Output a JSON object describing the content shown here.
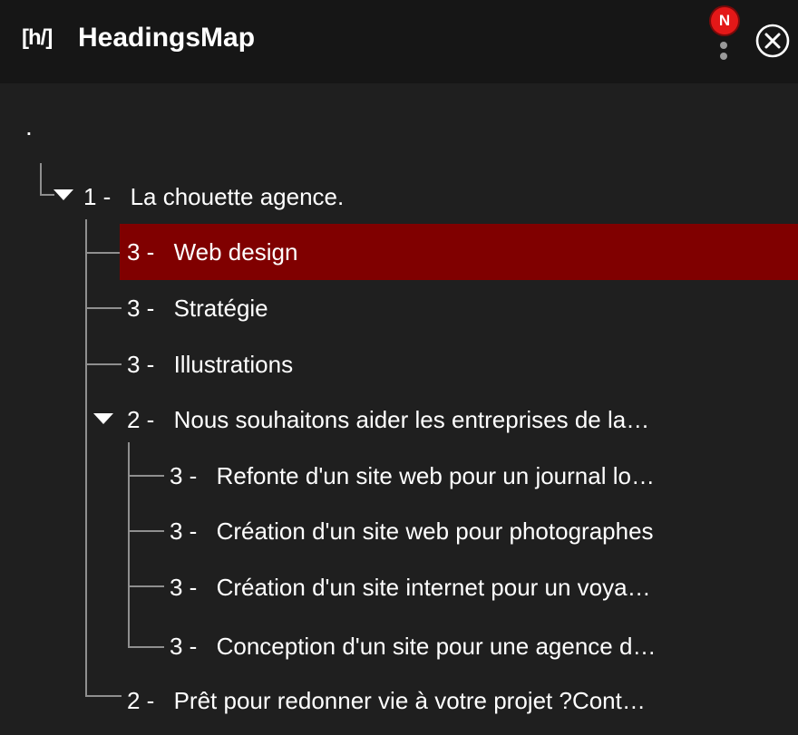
{
  "header": {
    "logo_text": "[h/]",
    "title": "HeadingsMap",
    "notification_badge": "N",
    "more_icon": "vertical-dots-icon",
    "close_icon": "close-circle-icon"
  },
  "tree": {
    "root_label": ".",
    "items": [
      {
        "level": "1 -",
        "text": "La chouette agence.",
        "expanded": true
      },
      {
        "level": "3 -",
        "text": "Web design",
        "selected": true
      },
      {
        "level": "3 -",
        "text": "Stratégie"
      },
      {
        "level": "3 -",
        "text": "Illustrations"
      },
      {
        "level": "2 -",
        "text": "Nous souhaitons aider les entreprises de la…",
        "expanded": true
      },
      {
        "level": "3 -",
        "text": "Refonte d'un site web pour un journal lo…"
      },
      {
        "level": "3 -",
        "text": "Création d'un site web pour photographes"
      },
      {
        "level": "3 -",
        "text": "Création d'un site internet pour un voya…"
      },
      {
        "level": "3 -",
        "text": "Conception d'un site pour une agence d…"
      },
      {
        "level": "2 -",
        "text": "Prêt pour redonner vie à votre projet ?Cont…"
      }
    ]
  },
  "colors": {
    "background": "#1f1f1f",
    "header_background": "#161616",
    "selected_row": "#800000",
    "badge": "#e31818",
    "tree_lines": "#8f8f8f"
  }
}
